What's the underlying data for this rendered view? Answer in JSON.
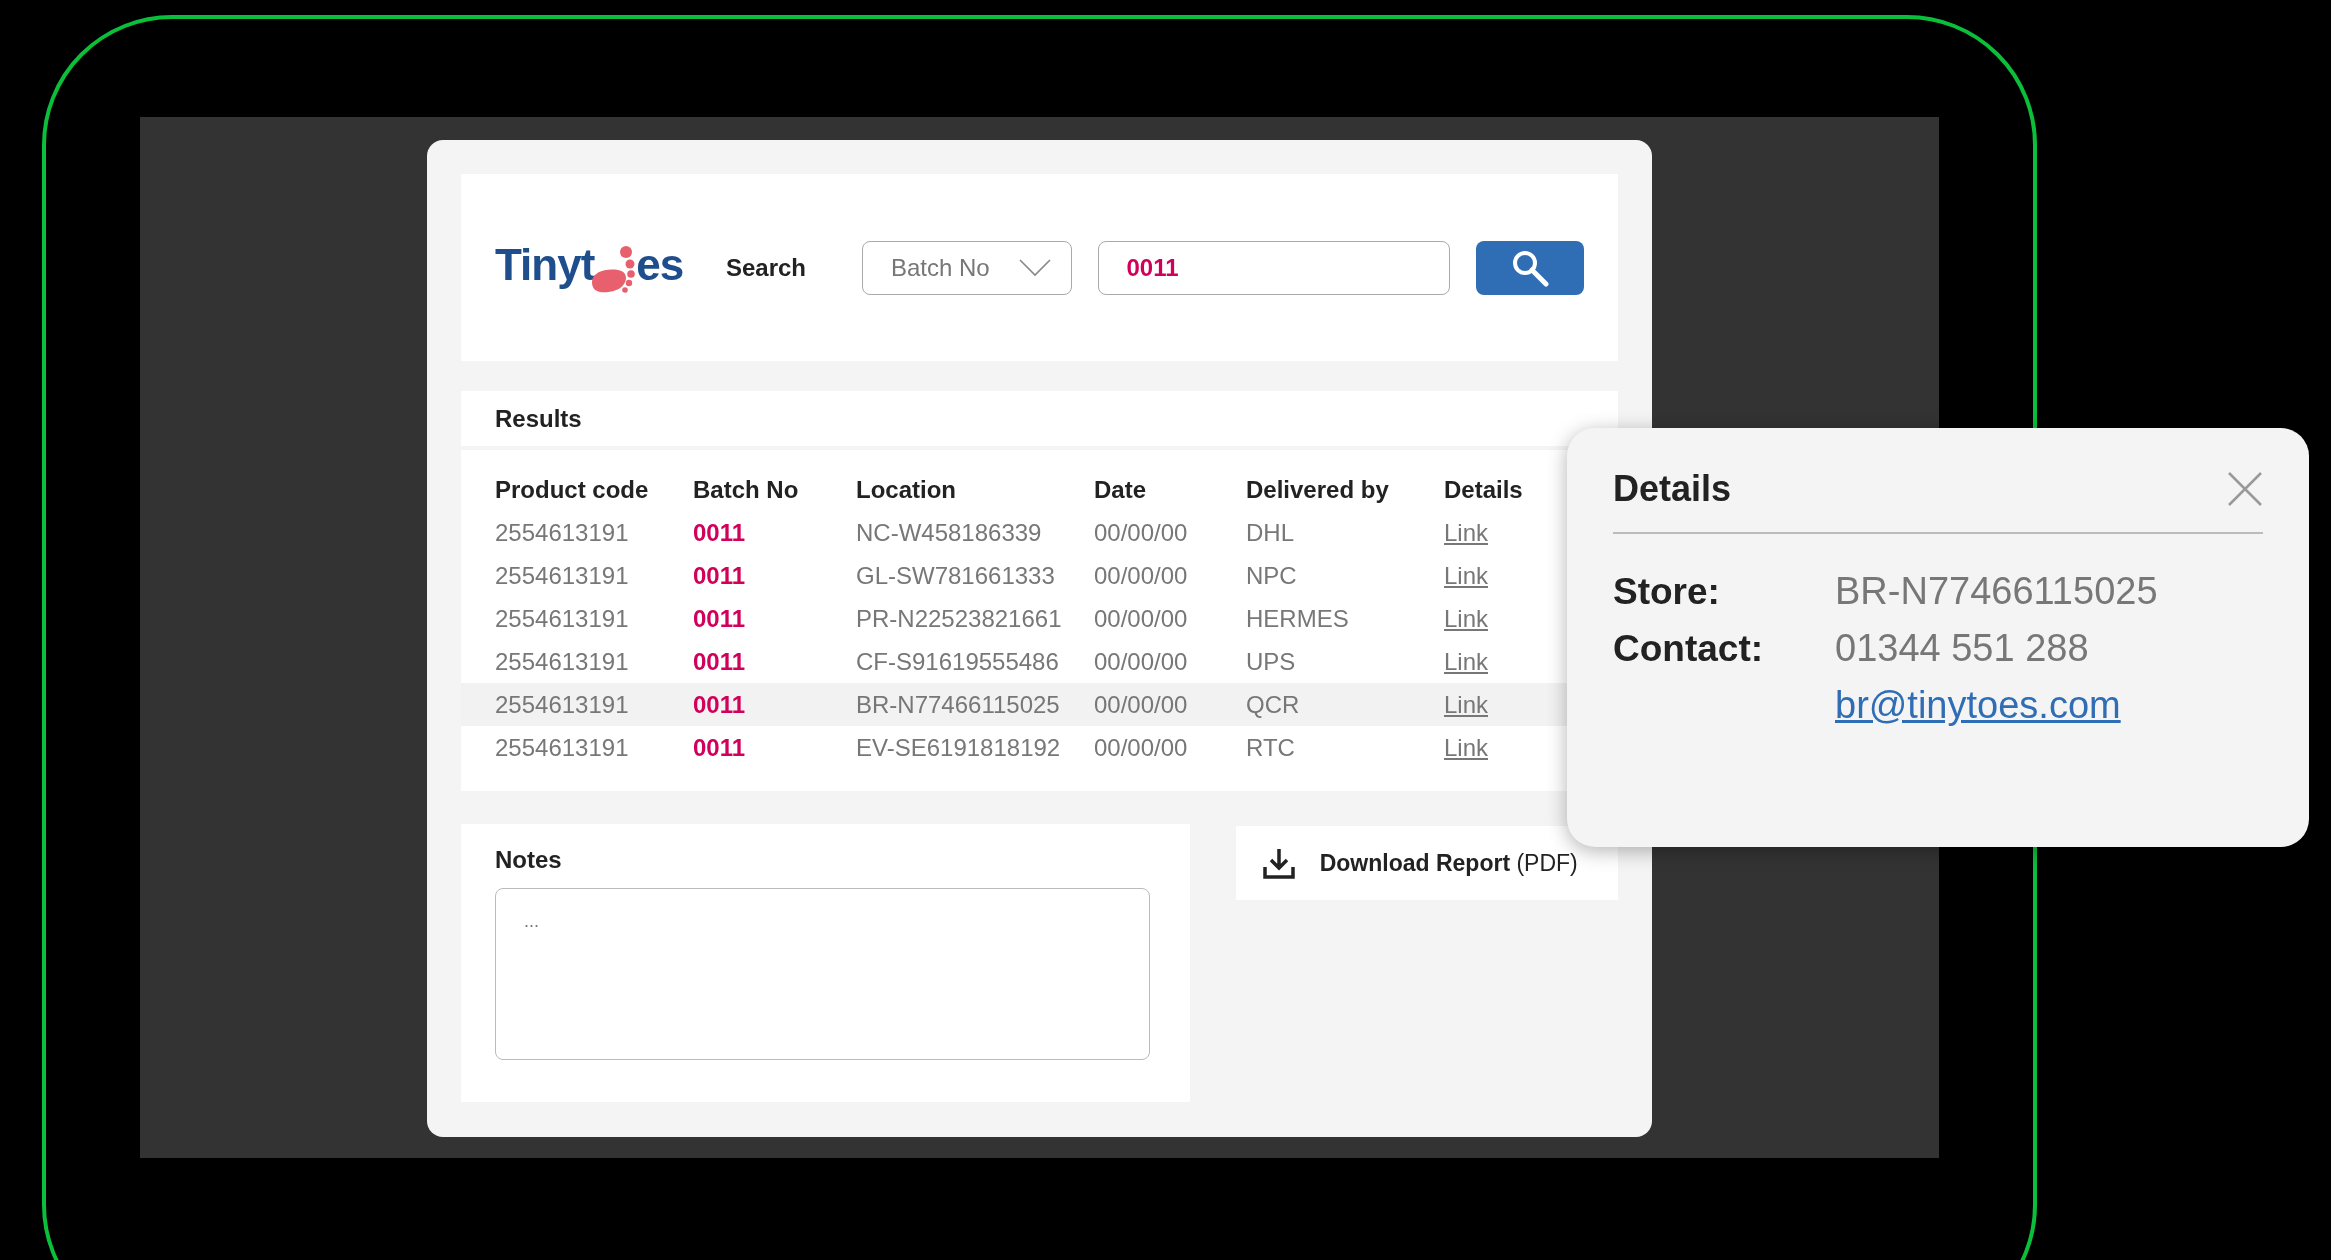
{
  "logo": {
    "before": "Tinyt",
    "after": "es"
  },
  "search": {
    "label": "Search",
    "filter": "Batch No",
    "value": "0011"
  },
  "results": {
    "title": "Results",
    "columns": [
      "Product code",
      "Batch No",
      "Location",
      "Date",
      "Delivered by",
      "Details"
    ],
    "rows": [
      {
        "product_code": "2554613191",
        "batch_no": "0011",
        "location": "NC-W458186339",
        "date": "00/00/00",
        "delivered_by": "DHL",
        "details": "Link",
        "selected": false
      },
      {
        "product_code": "2554613191",
        "batch_no": "0011",
        "location": "GL-SW781661333",
        "date": "00/00/00",
        "delivered_by": "NPC",
        "details": "Link",
        "selected": false
      },
      {
        "product_code": "2554613191",
        "batch_no": "0011",
        "location": "PR-N22523821661",
        "date": "00/00/00",
        "delivered_by": "HERMES",
        "details": "Link",
        "selected": false
      },
      {
        "product_code": "2554613191",
        "batch_no": "0011",
        "location": "CF-S91619555486",
        "date": "00/00/00",
        "delivered_by": "UPS",
        "details": "Link",
        "selected": false
      },
      {
        "product_code": "2554613191",
        "batch_no": "0011",
        "location": "BR-N77466115025",
        "date": "00/00/00",
        "delivered_by": "QCR",
        "details": "Link",
        "selected": true
      },
      {
        "product_code": "2554613191",
        "batch_no": "0011",
        "location": "EV-SE6191818192",
        "date": "00/00/00",
        "delivered_by": "RTC",
        "details": "Link",
        "selected": false
      }
    ]
  },
  "notes": {
    "title": "Notes",
    "placeholder": "..."
  },
  "download": {
    "label": "**Download Report** (PDF)"
  },
  "details_popup": {
    "title": "Details",
    "store_label": "Store:",
    "store": "BR-N77466115025",
    "contact_label": "Contact:",
    "phone": "01344 551 288",
    "email": "br@tinytoes.com"
  }
}
